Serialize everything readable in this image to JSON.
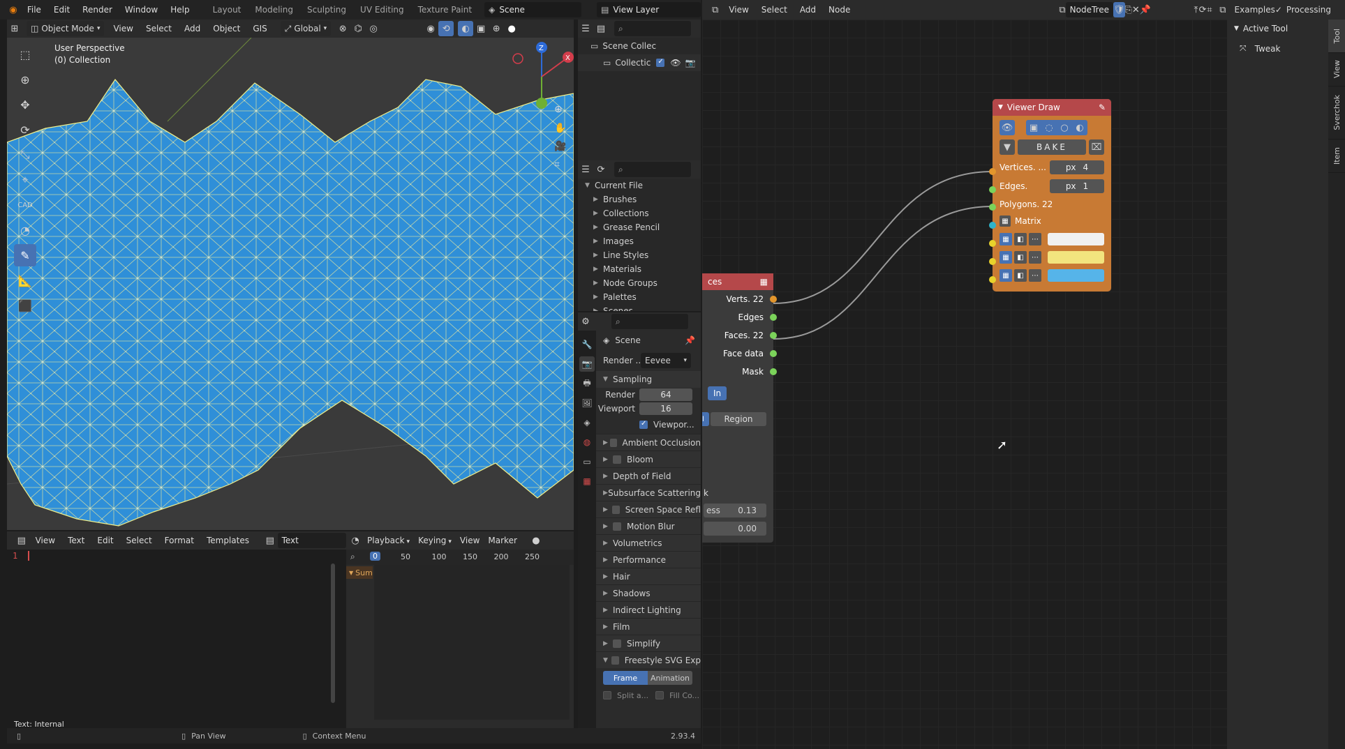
{
  "topbar": {
    "menu": [
      "File",
      "Edit",
      "Render",
      "Window",
      "Help"
    ],
    "workspaces": [
      "Layout",
      "Modeling",
      "Sculpting",
      "UV Editing",
      "Texture Paint"
    ],
    "scene": "Scene",
    "view_layer": "View Layer"
  },
  "viewport": {
    "mode": "Object Mode",
    "menus": [
      "View",
      "Select",
      "Add",
      "Object",
      "GIS"
    ],
    "orientation": "Global",
    "title": "User Perspective",
    "subtitle": "(0) Collection",
    "accent": "#2f8fd8"
  },
  "outliner": {
    "scene_collection": "Scene Collec",
    "collection": "Collectic"
  },
  "blend_file": {
    "root": "Current File",
    "items": [
      "Brushes",
      "Collections",
      "Grease Pencil",
      "Images",
      "Line Styles",
      "Materials",
      "Node Groups",
      "Palettes",
      "Scenes"
    ]
  },
  "properties": {
    "scene_name": "Scene",
    "render_engine_label": "Render ...",
    "render_engine": "Eevee",
    "sampling": {
      "title": "Sampling",
      "render_label": "Render",
      "render_value": "64",
      "viewport_label": "Viewport",
      "viewport_value": "16",
      "denoise_label": "Viewpor..."
    },
    "panels": [
      {
        "label": "Ambient Occlusion",
        "check": true
      },
      {
        "label": "Bloom",
        "check": true
      },
      {
        "label": "Depth of Field",
        "check": false
      },
      {
        "label": "Subsurface Scattering",
        "check": false
      },
      {
        "label": "Screen Space Refl",
        "check": true
      },
      {
        "label": "Motion Blur",
        "check": true
      },
      {
        "label": "Volumetrics",
        "check": false
      },
      {
        "label": "Performance",
        "check": false
      },
      {
        "label": "Hair",
        "check": false
      },
      {
        "label": "Shadows",
        "check": false
      },
      {
        "label": "Indirect Lighting",
        "check": false
      },
      {
        "label": "Film",
        "check": false
      },
      {
        "label": "Simplify",
        "check": true
      },
      {
        "label": "Freestyle SVG Exp",
        "check": true
      }
    ],
    "frame_btn": "Frame",
    "animation_btn": "Animation",
    "split_label": "Split a...",
    "fill_label": "Fill Co..."
  },
  "text_editor": {
    "menus": [
      "View",
      "Text",
      "Edit",
      "Select",
      "Format",
      "Templates"
    ],
    "text_name": "Text",
    "line_number": "1",
    "status": "Text: Internal"
  },
  "timeline": {
    "menus": [
      "Playback",
      "Keying",
      "View",
      "Marker"
    ],
    "frame": "0",
    "ticks": [
      "50",
      "100",
      "150",
      "200",
      "250"
    ],
    "summary": "Sum"
  },
  "node_editor": {
    "menus": [
      "View",
      "Select",
      "Add",
      "Node"
    ],
    "tree": "NodeTree",
    "examples": "Examples",
    "processing": "Processing",
    "sidebar_title": "Active Tool",
    "tweak": "Tweak",
    "tabs": [
      "Tool",
      "View",
      "Sverchok",
      "Item"
    ]
  },
  "node_viewer": {
    "title": "Viewer Draw",
    "bake": "BAKE",
    "vertices_label": "Vertices. ...",
    "vertices_unit": "px",
    "vertices_size": "4",
    "edges_label": "Edges.",
    "edges_unit": "px",
    "edges_size": "1",
    "polygons_label": "Polygons. 22",
    "matrix_label": "Matrix",
    "colors": {
      "header": "#b5484a",
      "body": "#c87a34"
    },
    "swatches": [
      "#f0f0f0",
      "#f2e47e",
      "#56b4e9"
    ]
  },
  "node_faces": {
    "title": "ces",
    "outputs": [
      "Verts. 22",
      "Edges",
      "Faces. 22",
      "Face data",
      "Mask"
    ],
    "in_label": "In",
    "region_label": "Region",
    "l_label": "l",
    "k_label": "k",
    "ess_label": "ess",
    "ess_value": "0.13",
    "zero_value": "0.00"
  },
  "statusbar": {
    "pan": "Pan View",
    "context": "Context Menu",
    "version": "2.93.4"
  }
}
